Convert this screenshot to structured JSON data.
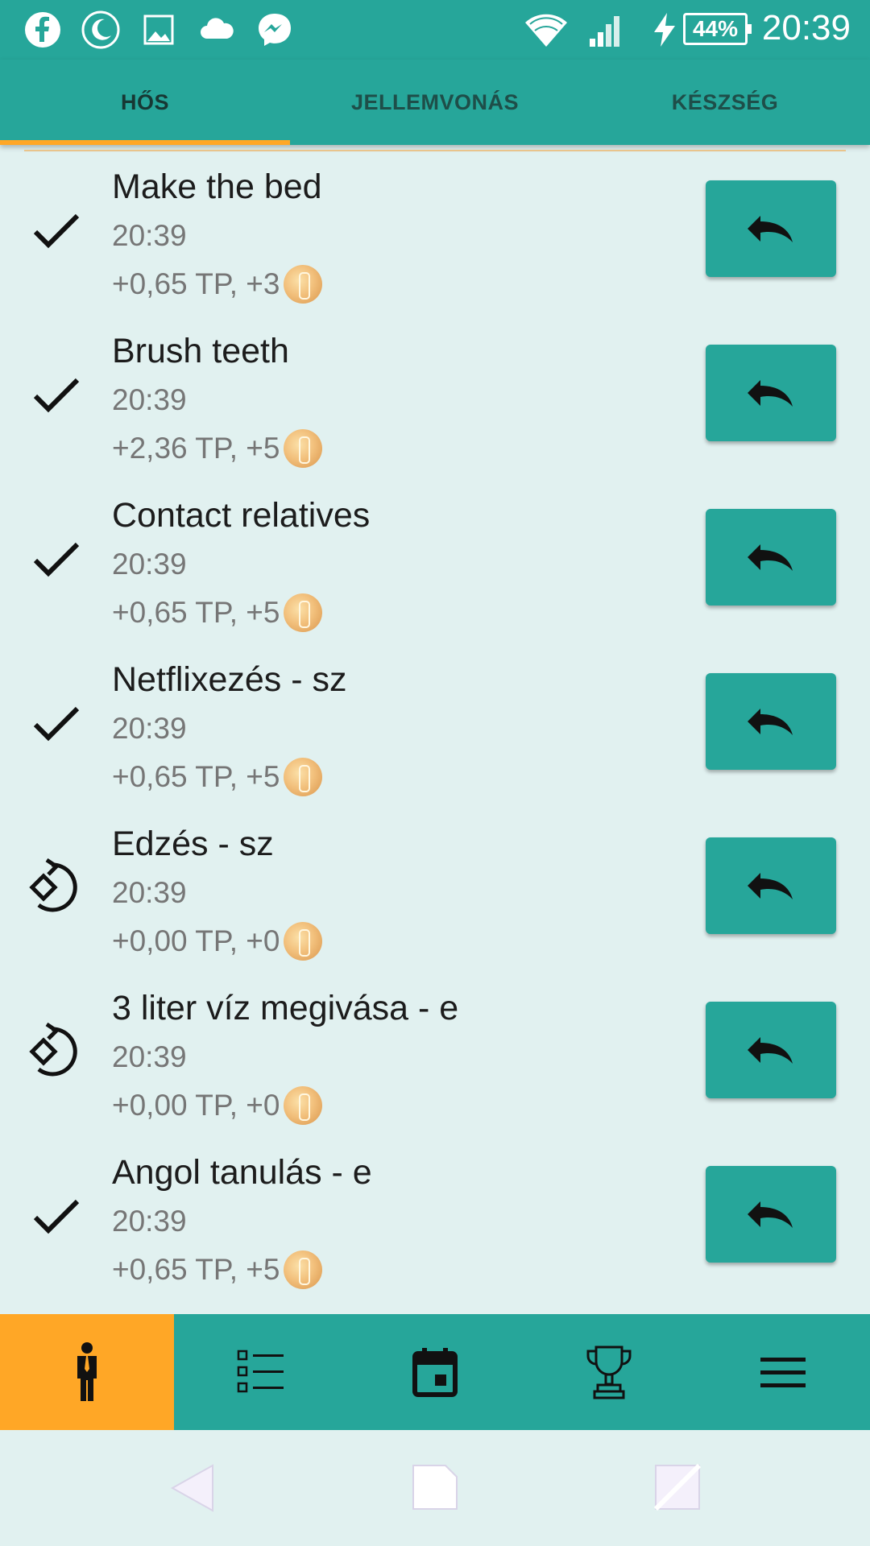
{
  "status_bar": {
    "time": "20:39",
    "battery_percent": "44%",
    "notification_icons": [
      "facebook-icon",
      "night-mode-icon",
      "gallery-icon",
      "cloud-icon",
      "messenger-icon"
    ],
    "system_icons": [
      "wifi-icon",
      "signal-icon",
      "charging-icon",
      "battery-icon"
    ]
  },
  "tabs": [
    {
      "label": "HŐS",
      "active": true
    },
    {
      "label": "JELLEMVONÁS",
      "active": false
    },
    {
      "label": "KÉSZSÉG",
      "active": false
    }
  ],
  "items": [
    {
      "title": "Make the bed",
      "time": "20:39",
      "reward": "+0,65 TP, +3",
      "status_icon": "check-icon"
    },
    {
      "title": "Brush teeth",
      "time": "20:39",
      "reward": "+2,36 TP, +5",
      "status_icon": "check-icon"
    },
    {
      "title": "Contact relatives",
      "time": "20:39",
      "reward": "+0,65 TP, +5",
      "status_icon": "check-icon"
    },
    {
      "title": "Netflixezés - sz",
      "time": "20:39",
      "reward": "+0,65 TP, +5",
      "status_icon": "check-icon"
    },
    {
      "title": "Edzés - sz",
      "time": "20:39",
      "reward": "+0,00 TP, +0",
      "status_icon": "skip-icon"
    },
    {
      "title": "3 liter víz megivása - e",
      "time": "20:39",
      "reward": "+0,00 TP, +0",
      "status_icon": "skip-icon"
    },
    {
      "title": "Angol tanulás - e",
      "time": "20:39",
      "reward": "+0,65 TP, +5",
      "status_icon": "check-icon"
    }
  ],
  "bottom_nav": [
    {
      "icon": "hero-person-icon",
      "active": true
    },
    {
      "icon": "task-list-icon",
      "active": false
    },
    {
      "icon": "calendar-icon",
      "active": false
    },
    {
      "icon": "trophy-icon",
      "active": false
    },
    {
      "icon": "menu-icon",
      "active": false
    }
  ],
  "colors": {
    "primary": "#26a69a",
    "accent": "#ffa726",
    "background": "#e1f1f0"
  }
}
